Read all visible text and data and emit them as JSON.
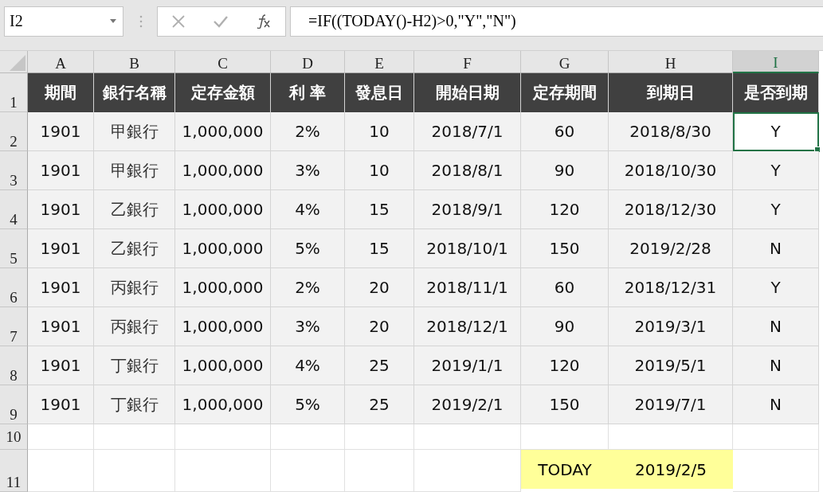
{
  "name_box": "I2",
  "formula": "=IF((TODAY()-H2)>0,\"Y\",\"N\")",
  "columns": [
    {
      "label": "A",
      "selected": false
    },
    {
      "label": "B",
      "selected": false
    },
    {
      "label": "C",
      "selected": false
    },
    {
      "label": "D",
      "selected": false
    },
    {
      "label": "E",
      "selected": false
    },
    {
      "label": "F",
      "selected": false
    },
    {
      "label": "G",
      "selected": false
    },
    {
      "label": "H",
      "selected": false
    },
    {
      "label": "I",
      "selected": true
    }
  ],
  "header_row": {
    "number": "1",
    "cells": [
      "期間",
      "銀行名稱",
      "定存金額",
      "利 率",
      "發息日",
      "開始日期",
      "定存期間",
      "到期日",
      "是否到期"
    ]
  },
  "rows": [
    {
      "number": "2",
      "cells": [
        {
          "text": "1901",
          "selected": false
        },
        {
          "text": "甲銀行",
          "selected": false
        },
        {
          "text": "1,000,000",
          "selected": false
        },
        {
          "text": "2%",
          "selected": false
        },
        {
          "text": "10",
          "selected": false
        },
        {
          "text": "2018/7/1",
          "selected": false
        },
        {
          "text": "60",
          "selected": false
        },
        {
          "text": "2018/8/30",
          "selected": false
        },
        {
          "text": "Y",
          "selected": true
        }
      ]
    },
    {
      "number": "3",
      "cells": [
        {
          "text": "1901",
          "selected": false
        },
        {
          "text": "甲銀行",
          "selected": false
        },
        {
          "text": "1,000,000",
          "selected": false
        },
        {
          "text": "3%",
          "selected": false
        },
        {
          "text": "10",
          "selected": false
        },
        {
          "text": "2018/8/1",
          "selected": false
        },
        {
          "text": "90",
          "selected": false
        },
        {
          "text": "2018/10/30",
          "selected": false
        },
        {
          "text": "Y",
          "selected": false
        }
      ]
    },
    {
      "number": "4",
      "cells": [
        {
          "text": "1901",
          "selected": false
        },
        {
          "text": "乙銀行",
          "selected": false
        },
        {
          "text": "1,000,000",
          "selected": false
        },
        {
          "text": "4%",
          "selected": false
        },
        {
          "text": "15",
          "selected": false
        },
        {
          "text": "2018/9/1",
          "selected": false
        },
        {
          "text": "120",
          "selected": false
        },
        {
          "text": "2018/12/30",
          "selected": false
        },
        {
          "text": "Y",
          "selected": false
        }
      ]
    },
    {
      "number": "5",
      "cells": [
        {
          "text": "1901",
          "selected": false
        },
        {
          "text": "乙銀行",
          "selected": false
        },
        {
          "text": "1,000,000",
          "selected": false
        },
        {
          "text": "5%",
          "selected": false
        },
        {
          "text": "15",
          "selected": false
        },
        {
          "text": "2018/10/1",
          "selected": false
        },
        {
          "text": "150",
          "selected": false
        },
        {
          "text": "2019/2/28",
          "selected": false
        },
        {
          "text": "N",
          "selected": false
        }
      ]
    },
    {
      "number": "6",
      "cells": [
        {
          "text": "1901",
          "selected": false
        },
        {
          "text": "丙銀行",
          "selected": false
        },
        {
          "text": "1,000,000",
          "selected": false
        },
        {
          "text": "2%",
          "selected": false
        },
        {
          "text": "20",
          "selected": false
        },
        {
          "text": "2018/11/1",
          "selected": false
        },
        {
          "text": "60",
          "selected": false
        },
        {
          "text": "2018/12/31",
          "selected": false
        },
        {
          "text": "Y",
          "selected": false
        }
      ]
    },
    {
      "number": "7",
      "cells": [
        {
          "text": "1901",
          "selected": false
        },
        {
          "text": "丙銀行",
          "selected": false
        },
        {
          "text": "1,000,000",
          "selected": false
        },
        {
          "text": "3%",
          "selected": false
        },
        {
          "text": "20",
          "selected": false
        },
        {
          "text": "2018/12/1",
          "selected": false
        },
        {
          "text": "90",
          "selected": false
        },
        {
          "text": "2019/3/1",
          "selected": false
        },
        {
          "text": "N",
          "selected": false
        }
      ]
    },
    {
      "number": "8",
      "cells": [
        {
          "text": "1901",
          "selected": false
        },
        {
          "text": "丁銀行",
          "selected": false
        },
        {
          "text": "1,000,000",
          "selected": false
        },
        {
          "text": "4%",
          "selected": false
        },
        {
          "text": "25",
          "selected": false
        },
        {
          "text": "2019/1/1",
          "selected": false
        },
        {
          "text": "120",
          "selected": false
        },
        {
          "text": "2019/5/1",
          "selected": false
        },
        {
          "text": "N",
          "selected": false
        }
      ]
    },
    {
      "number": "9",
      "cells": [
        {
          "text": "1901",
          "selected": false
        },
        {
          "text": "丁銀行",
          "selected": false
        },
        {
          "text": "1,000,000",
          "selected": false
        },
        {
          "text": "5%",
          "selected": false
        },
        {
          "text": "25",
          "selected": false
        },
        {
          "text": "2019/2/1",
          "selected": false
        },
        {
          "text": "150",
          "selected": false
        },
        {
          "text": "2019/7/1",
          "selected": false
        },
        {
          "text": "N",
          "selected": false
        }
      ]
    }
  ],
  "empty_row": {
    "number": "10"
  },
  "today_row": {
    "number": "11",
    "label": "TODAY",
    "value": "2019/2/5"
  }
}
